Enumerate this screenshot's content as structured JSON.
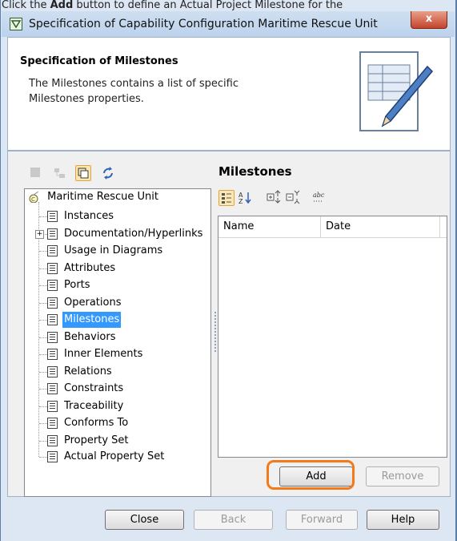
{
  "caption": {
    "prefix": "Click the ",
    "bold": "Add",
    "suffix": " button to define an Actual Project Milestone for the"
  },
  "window": {
    "title": "Specification of Capability Configuration Maritime Rescue Unit",
    "close_label": "x"
  },
  "header": {
    "title": "Specification of Milestones",
    "description": "The Milestones contains a list of specific Milestones properties."
  },
  "tree": {
    "root": "Maritime Rescue Unit",
    "items": [
      {
        "label": "Instances"
      },
      {
        "label": "Documentation/Hyperlinks",
        "expand": "+"
      },
      {
        "label": "Usage in Diagrams"
      },
      {
        "label": "Attributes"
      },
      {
        "label": "Ports"
      },
      {
        "label": "Operations"
      },
      {
        "label": "Milestones",
        "selected": true
      },
      {
        "label": "Behaviors"
      },
      {
        "label": "Inner Elements"
      },
      {
        "label": "Relations"
      },
      {
        "label": "Constraints"
      },
      {
        "label": "Traceability"
      },
      {
        "label": "Conforms To"
      },
      {
        "label": "Property Set"
      },
      {
        "label": "Actual Property Set"
      }
    ]
  },
  "panel": {
    "title": "Milestones",
    "columns": [
      "Name",
      "Date"
    ],
    "add_label": "Add",
    "remove_label": "Remove"
  },
  "footer": {
    "close": "Close",
    "back": "Back",
    "forward": "Forward",
    "help": "Help"
  },
  "colors": {
    "highlight": "#f27a1b",
    "selection": "#3399ff"
  }
}
